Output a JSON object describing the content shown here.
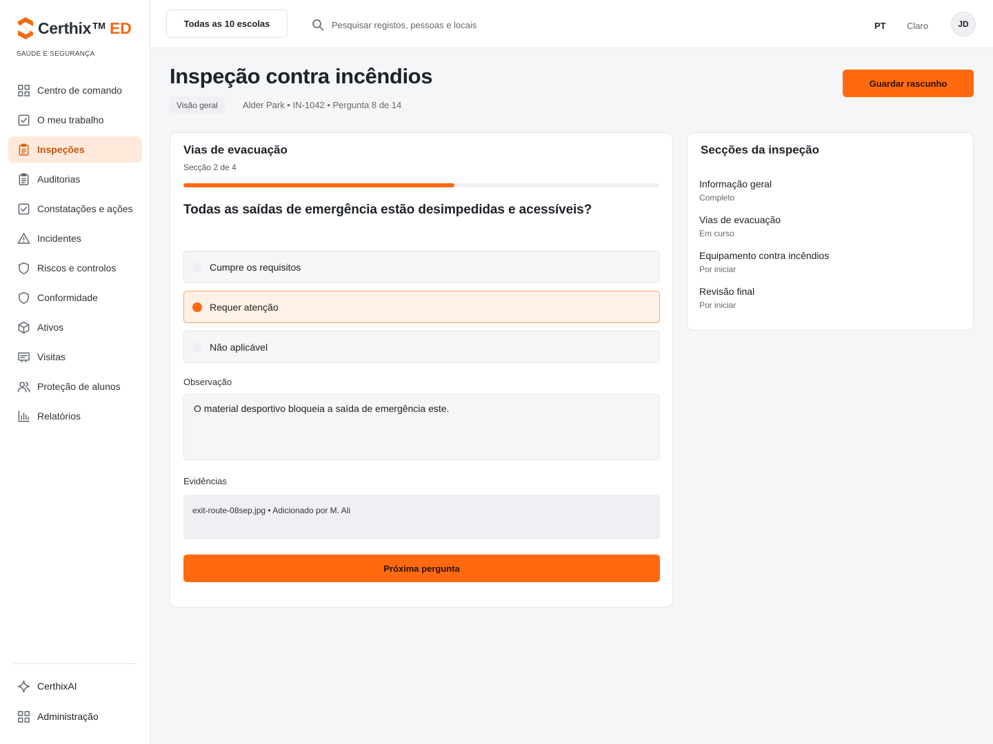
{
  "brand": {
    "name": "Certhix",
    "tm": "TM",
    "suffix": "ED",
    "subtitle": "SAÚDE E SEGURANÇA",
    "accent": "#f26a10"
  },
  "nav": {
    "items": [
      {
        "label": "Centro de comando",
        "icon": "grid-icon"
      },
      {
        "label": "O meu trabalho",
        "icon": "checkbox-icon"
      },
      {
        "label": "Inspeções",
        "icon": "clipboard-icon",
        "active": true
      },
      {
        "label": "Auditorias",
        "icon": "clipboard-list-icon"
      },
      {
        "label": "Constatações e ações",
        "icon": "checkbox-icon"
      },
      {
        "label": "Incidentes",
        "icon": "warning-icon"
      },
      {
        "label": "Riscos e controlos",
        "icon": "shield-icon"
      },
      {
        "label": "Conformidade",
        "icon": "shield-icon"
      },
      {
        "label": "Ativos",
        "icon": "cube-icon"
      },
      {
        "label": "Visitas",
        "icon": "badge-icon"
      },
      {
        "label": "Proteção de alunos",
        "icon": "users-icon"
      },
      {
        "label": "Relatórios",
        "icon": "bar-chart-icon"
      }
    ],
    "bottom": [
      {
        "label": "CerthixAI",
        "icon": "sparkle-icon"
      },
      {
        "label": "Administração",
        "icon": "grid-icon"
      }
    ]
  },
  "topbar": {
    "school_selector": "Todas as 10 escolas",
    "search_placeholder": "Pesquisar registos, pessoas e locais",
    "language": "PT",
    "theme": "Claro",
    "user_initials": "JD"
  },
  "header": {
    "title": "Inspeção contra incêndios",
    "tag": "Visão geral",
    "meta": "Alder Park • IN-1042 • Pergunta 8 de 14",
    "save_label": "Guardar rascunho"
  },
  "section": {
    "title": "Vias de evacuação",
    "subtitle": "Secção 2 de 4",
    "progress": 0.57,
    "question": "Todas as saídas de emergência estão desimpedidas e acessíveis?",
    "options": [
      {
        "label": "Cumpre os requisitos",
        "selected": false
      },
      {
        "label": "Requer atenção",
        "selected": true
      },
      {
        "label": "Não aplicável",
        "selected": false
      }
    ],
    "observation_label": "Observação",
    "observation_value": "O material desportivo bloqueia a saída de emergência este.",
    "evidence_label": "Evidências",
    "evidence_item": "exit-route-08sep.jpg • Adicionado por M. Ali",
    "next_label": "Próxima pergunta"
  },
  "sections_panel": {
    "title": "Secções da inspeção",
    "items": [
      {
        "name": "Informação geral",
        "status": "Completo"
      },
      {
        "name": "Vias de evacuação",
        "status": "Em curso"
      },
      {
        "name": "Equipamento contra incêndios",
        "status": "Por iniciar"
      },
      {
        "name": "Revisão final",
        "status": "Por iniciar"
      }
    ]
  }
}
